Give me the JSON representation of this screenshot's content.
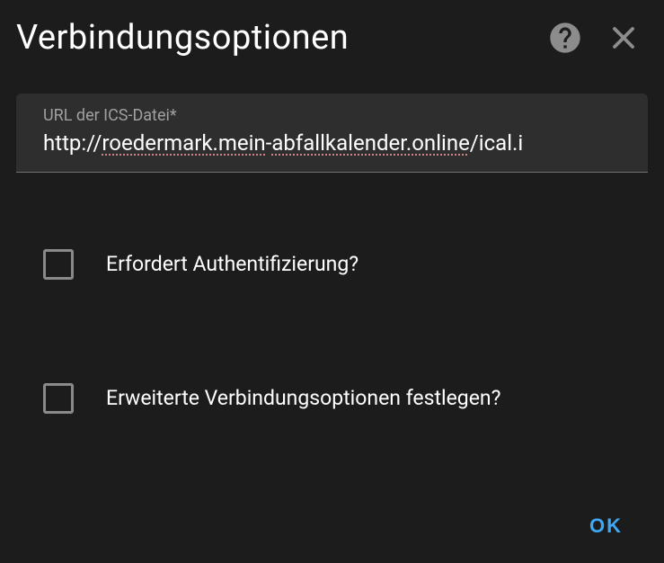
{
  "dialog": {
    "title": "Verbindungsoptionen"
  },
  "input": {
    "label": "URL der ICS-Datei*",
    "prefix": "http://",
    "spell1": "roedermark.mein",
    "hyphen": "-",
    "spell2": "abfallkalender.online",
    "suffix": "/ical.i"
  },
  "checkbox1": {
    "label": "Erfordert Authentifizierung?"
  },
  "checkbox2": {
    "label": "Erweiterte Verbindungsoptionen festlegen?"
  },
  "actions": {
    "ok": "OK"
  }
}
